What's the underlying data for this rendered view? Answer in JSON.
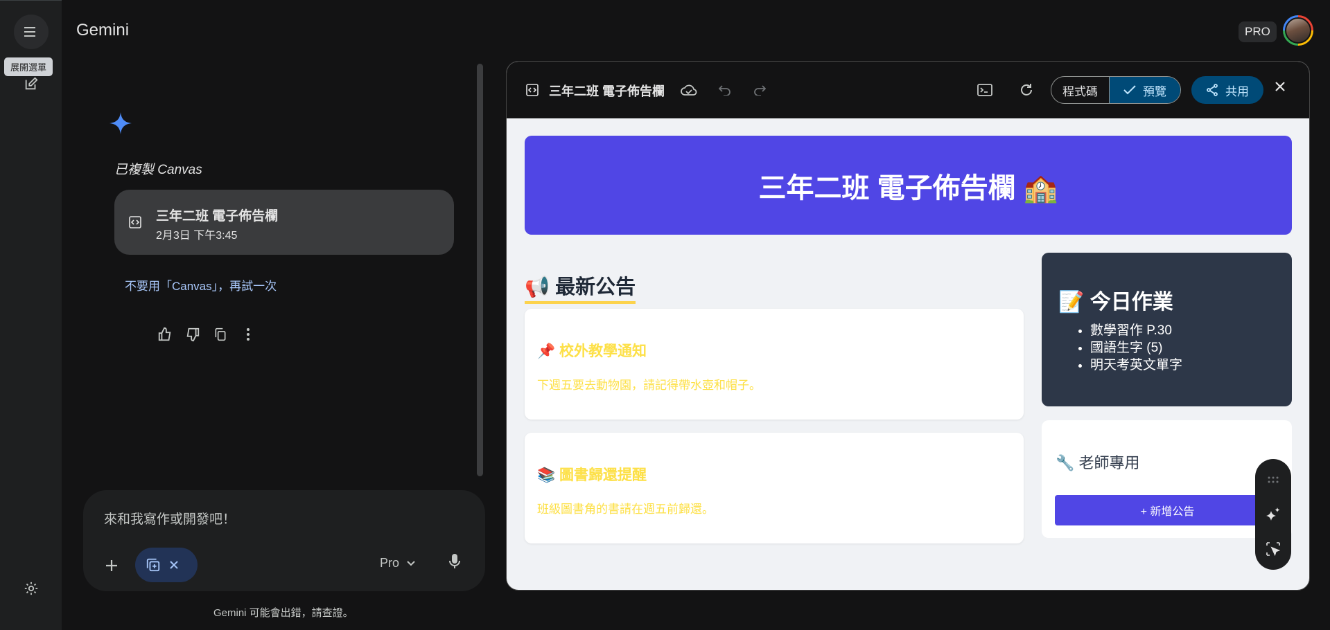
{
  "app": {
    "title": "Gemini",
    "tier_badge": "PRO"
  },
  "rail": {
    "tooltip": "展開選單"
  },
  "chat": {
    "status": "已複製 Canvas",
    "card": {
      "title": "三年二班 電子佈告欄",
      "timestamp": "2月3日 下午3:45"
    },
    "retry_link": "不要用「Canvas」，再試一次",
    "icons": [
      "thumb-up-icon",
      "thumb-down-icon",
      "copy-icon",
      "more-vert-icon"
    ]
  },
  "composer": {
    "placeholder": "來和我寫作或開發吧！",
    "model": "Pro"
  },
  "disclaimer": "Gemini 可能會出錯，請查證。",
  "canvas": {
    "title": "三年二班 電子佈告欄",
    "code_tab": "程式碼",
    "preview_tab": "預覽",
    "share_label": "共用"
  },
  "preview": {
    "banner": "三年二班 電子佈告欄 🏫",
    "announcements_title": "📢 最新公告",
    "announcements": [
      {
        "title": "📌 校外教學通知",
        "body": "下週五要去動物園，請記得帶水壺和帽子。"
      },
      {
        "title": "📚 圖書歸還提醒",
        "body": "班級圖書角的書請在週五前歸還。"
      }
    ],
    "homework_title": "📝 今日作業",
    "homework": [
      "數學習作 P.30",
      "國語生字 (5)",
      "明天考英文單字"
    ],
    "teacher_title": "🔧 老師專用",
    "add_button": "+ 新增公告"
  },
  "colors": {
    "banner": "#5046e5",
    "accent_yellow": "#fde047",
    "homework_bg": "#2d3748",
    "link_blue": "#a8c7fa"
  }
}
